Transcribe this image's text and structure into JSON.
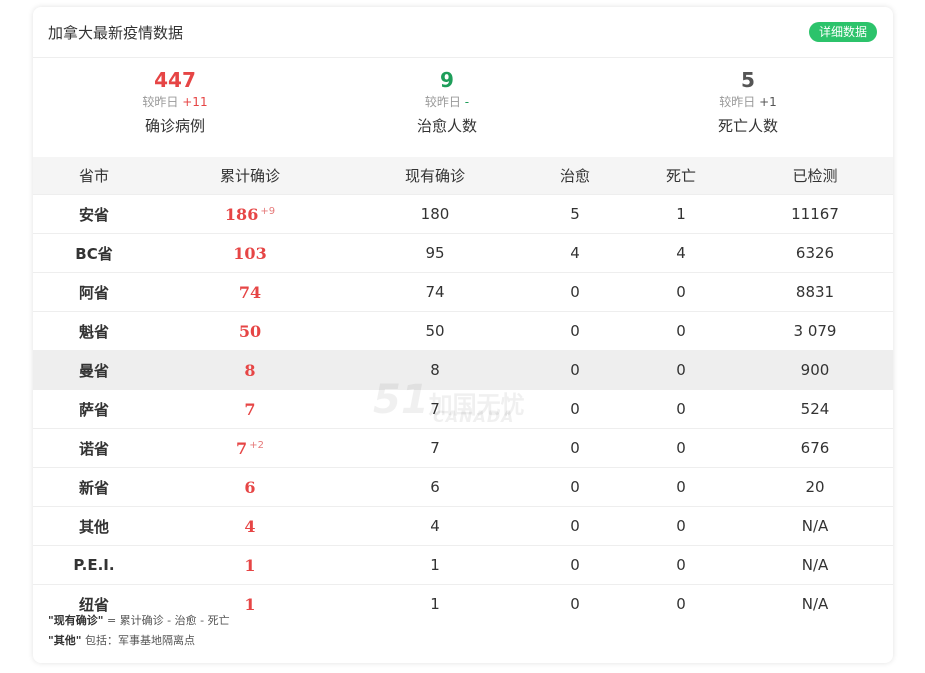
{
  "header": {
    "title": "加拿大最新疫情数据",
    "detail_button": "详细数据"
  },
  "summary": [
    {
      "number": "447",
      "delta_label": "较昨日",
      "delta": "+11",
      "label": "确诊病例",
      "color": "#e64545"
    },
    {
      "number": "9",
      "delta_label": "较昨日",
      "delta": "-",
      "label": "治愈人数",
      "color": "#1e9e5a"
    },
    {
      "number": "5",
      "delta_label": "较昨日",
      "delta": "+1",
      "label": "死亡人数",
      "color": "#555555"
    }
  ],
  "table": {
    "headers": [
      "省市",
      "累计确诊",
      "现有确诊",
      "治愈",
      "死亡",
      "已检测"
    ],
    "rows": [
      {
        "province": "安省",
        "confirmed": "186",
        "delta": "+9",
        "active": "180",
        "cured": "5",
        "dead": "1",
        "tested": "11167"
      },
      {
        "province": "BC省",
        "confirmed": "103",
        "delta": "",
        "active": "95",
        "cured": "4",
        "dead": "4",
        "tested": "6326"
      },
      {
        "province": "阿省",
        "confirmed": "74",
        "delta": "",
        "active": "74",
        "cured": "0",
        "dead": "0",
        "tested": "8831"
      },
      {
        "province": "魁省",
        "confirmed": "50",
        "delta": "",
        "active": "50",
        "cured": "0",
        "dead": "0",
        "tested": "3 079"
      },
      {
        "province": "曼省",
        "confirmed": "8",
        "delta": "",
        "active": "8",
        "cured": "0",
        "dead": "0",
        "tested": "900"
      },
      {
        "province": "萨省",
        "confirmed": "7",
        "delta": "",
        "active": "7",
        "cured": "0",
        "dead": "0",
        "tested": "524"
      },
      {
        "province": "诺省",
        "confirmed": "7",
        "delta": "+2",
        "active": "7",
        "cured": "0",
        "dead": "0",
        "tested": "676"
      },
      {
        "province": "新省",
        "confirmed": "6",
        "delta": "",
        "active": "6",
        "cured": "0",
        "dead": "0",
        "tested": "20"
      },
      {
        "province": "其他",
        "confirmed": "4",
        "delta": "",
        "active": "4",
        "cured": "0",
        "dead": "0",
        "tested": "N/A"
      },
      {
        "province": "P.E.I.",
        "confirmed": "1",
        "delta": "",
        "active": "1",
        "cured": "0",
        "dead": "0",
        "tested": "N/A"
      },
      {
        "province": "纽省",
        "confirmed": "1",
        "delta": "",
        "active": "1",
        "cured": "0",
        "dead": "0",
        "tested": "N/A"
      }
    ]
  },
  "notes": [
    {
      "term": "\"现有确诊\"",
      "text": " = 累计确诊 - 治愈 - 死亡"
    },
    {
      "term": "\"其他\"",
      "text": " 包括：军事基地隔离点"
    }
  ],
  "watermark": {
    "num": "51",
    "cn": "加国无忧",
    "en": "CANADA"
  },
  "colors": {
    "accent_green": "#2cc36b",
    "confirmed_red": "#e64545",
    "highlight_row": "#eeeeee"
  }
}
